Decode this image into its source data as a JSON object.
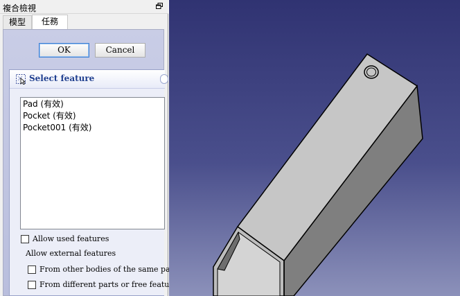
{
  "window": {
    "title": "複合檢視"
  },
  "tabs": [
    {
      "label": "模型"
    },
    {
      "label": "任務"
    }
  ],
  "dialog": {
    "ok_label": "OK",
    "cancel_label": "Cancel"
  },
  "select_feature": {
    "title": "Select feature",
    "items": [
      "Pad (有效)",
      "Pocket (有效)",
      "Pocket001 (有效)"
    ],
    "allow_used_label": "Allow used features",
    "allow_external_label": "Allow external features",
    "other_bodies_label": "From  other bodies of the same part",
    "different_parts_label": "From different parts or free features",
    "allow_used_checked": false,
    "other_bodies_checked": false,
    "different_parts_checked": false
  },
  "colors": {
    "viewport_top": "#303372",
    "viewport_bottom": "#8c91ba",
    "model_face_light": "#c8c8c8",
    "model_face_side": "#8a8a8a",
    "model_edge": "#000000"
  }
}
